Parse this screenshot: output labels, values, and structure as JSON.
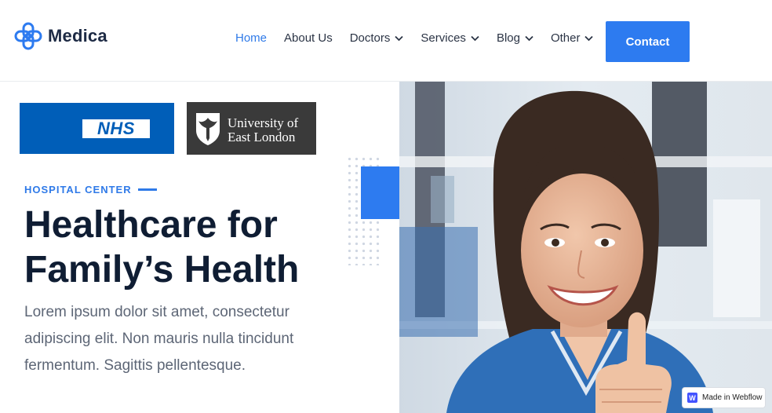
{
  "brand": {
    "name": "Medica",
    "logo_icon": "medical-cross-outline-icon"
  },
  "nav": {
    "items": [
      {
        "label": "Home",
        "active": true,
        "has_dropdown": false
      },
      {
        "label": "About Us",
        "active": false,
        "has_dropdown": false
      },
      {
        "label": "Doctors",
        "active": false,
        "has_dropdown": true
      },
      {
        "label": "Services",
        "active": false,
        "has_dropdown": true
      },
      {
        "label": "Blog",
        "active": false,
        "has_dropdown": true
      },
      {
        "label": "Other",
        "active": false,
        "has_dropdown": true
      }
    ],
    "contact_label": "Contact"
  },
  "partners": {
    "nhs_label": "NHS",
    "uel_line1": "University of",
    "uel_line2": "East London"
  },
  "hero": {
    "eyebrow": "HOSPITAL CENTER",
    "headline_line1": "Healthcare for",
    "headline_line2": "Family’s Health",
    "body": "Lorem ipsum dolor sit amet, consectetur adipiscing elit. Non mauris nulla tincidunt fermentum. Sagittis pellentesque."
  },
  "badge": {
    "label": "Made in Webflow"
  },
  "colors": {
    "accent": "#2d7bf0",
    "heading": "#0f1d33",
    "nhs_blue": "#005eb8",
    "uel_gray": "#3a3a3a"
  }
}
